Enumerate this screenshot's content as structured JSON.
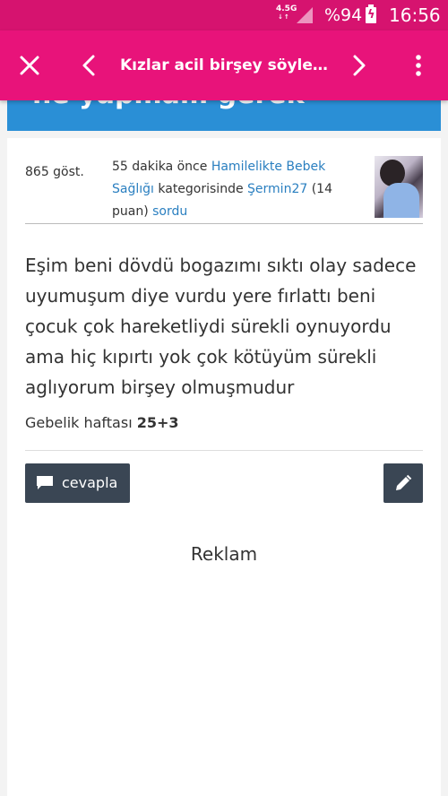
{
  "statusbar": {
    "network": "4.5G",
    "network_arrows": "↓↑",
    "battery_pct": "%94",
    "clock": "16:56"
  },
  "toolbar": {
    "title": "Kızlar acil birşey söyleyin..."
  },
  "banner": {
    "text": "ne yapmam gerek"
  },
  "question": {
    "views": "865 göst.",
    "time": "55 dakika önce",
    "category": "Hamilelikte Bebek Sağlığı",
    "category_suffix": "kategorisinde",
    "author": "Şermin27",
    "points": "(14 puan)",
    "action": "sordu",
    "body": "Eşim beni dövdü bogazımı sıktı olay sadece uyumuşum diye vurdu yere fırlattı beni çocuk çok hareketliydi sürekli oynuyordu ama hiç kıpırtı yok çok kötüyüm sürekli aglıyorum birşey olmuşmudur",
    "week_label": "Gebelik haftası",
    "week_value": "25+3"
  },
  "actions": {
    "reply_label": "cevapla"
  },
  "ad": {
    "label": "Reklam"
  },
  "colors": {
    "toolbar": "#e8137a",
    "statusbar": "#d6136f",
    "banner": "#2a8fd6",
    "link": "#2a7fc0",
    "button": "#3a4654"
  }
}
